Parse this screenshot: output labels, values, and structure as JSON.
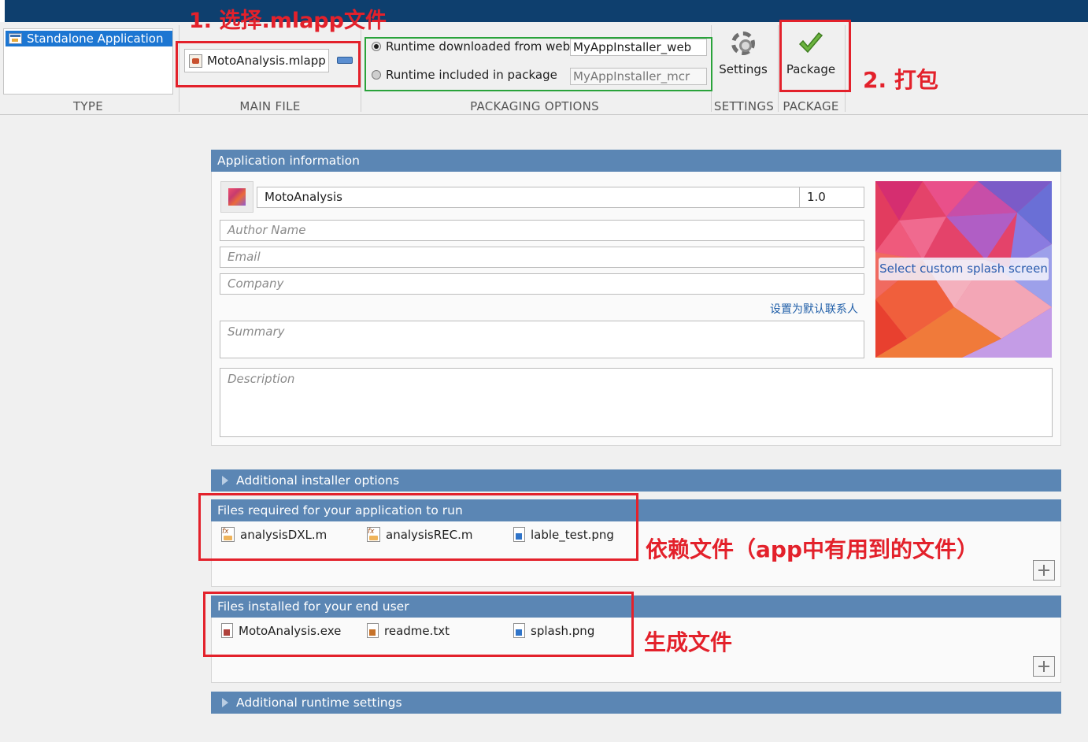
{
  "toolstrip": {
    "type": {
      "selected": "Standalone Application",
      "label": "TYPE"
    },
    "main_file": {
      "value": "MotoAnalysis.mlapp",
      "label": "MAIN FILE"
    },
    "packaging_options": {
      "label": "PACKAGING OPTIONS",
      "option_web": "Runtime downloaded from web",
      "option_web_value": "MyAppInstaller_web",
      "option_included": "Runtime included in package",
      "option_included_value": "MyAppInstaller_mcr",
      "selected": "option_web"
    },
    "settings": {
      "button_label": "Settings",
      "label": "SETTINGS"
    },
    "package": {
      "button_label": "Package",
      "label": "PACKAGE"
    }
  },
  "annotations": {
    "step1": "1. 选择.mlapp文件",
    "step2": "2. 打包",
    "dependency_note": "依赖文件（app中有用到的文件）",
    "generated_note": "生成文件",
    "color": "#e3212b",
    "packaging_box_color": "#2aa33b"
  },
  "app_info": {
    "header": "Application information",
    "name": "MotoAnalysis",
    "version": "1.0",
    "author_placeholder": "Author Name",
    "email_placeholder": "Email",
    "company_placeholder": "Company",
    "set_default_contact": "设置为默认联系人",
    "summary_placeholder": "Summary",
    "description_placeholder": "Description",
    "splash_button": "Select custom splash screen"
  },
  "sections": {
    "additional_installer": "Additional installer options",
    "files_required_header": "Files required for your application to run",
    "files_required": [
      "analysisDXL.m",
      "analysisREC.m",
      "lable_test.png"
    ],
    "files_installed_header": "Files installed for your end user",
    "files_installed": [
      "MotoAnalysis.exe",
      "readme.txt",
      "splash.png"
    ],
    "additional_runtime": "Additional runtime settings"
  },
  "colors": {
    "panel_header": "#5b86b4",
    "title_bar": "#0e3f6e",
    "selection": "#1c76d2",
    "link": "#1f5ea8"
  }
}
